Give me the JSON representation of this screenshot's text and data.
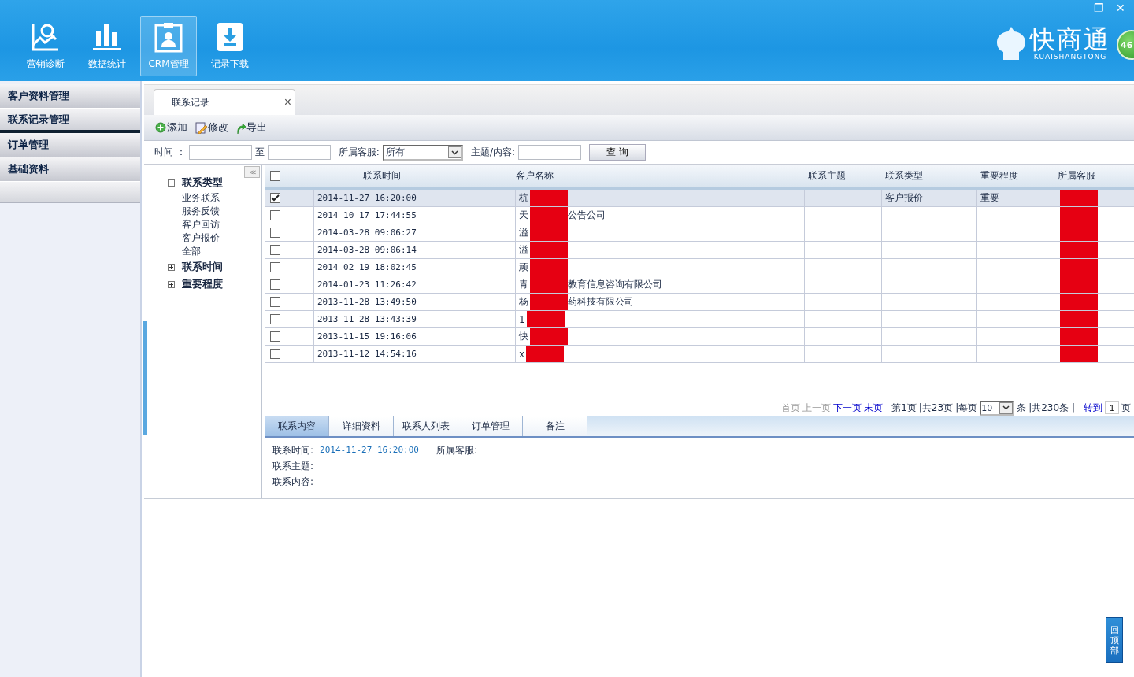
{
  "window": {
    "controls": [
      "–",
      "❐",
      "✕"
    ],
    "logo": {
      "name": "快商通",
      "sub": "KUAISHANGTONG"
    },
    "badge": "46"
  },
  "nav": [
    {
      "label": "营销诊断",
      "selected": false
    },
    {
      "label": "数据统计",
      "selected": false
    },
    {
      "label": "CRM管理",
      "selected": true
    },
    {
      "label": "记录下载",
      "selected": false
    }
  ],
  "sidebar": {
    "items": [
      {
        "label": "客户资料管理",
        "selected": false
      },
      {
        "label": "联系记录管理",
        "selected": true
      },
      {
        "label": "订单管理",
        "selected": false
      },
      {
        "label": "基础资料",
        "selected": false
      }
    ]
  },
  "tabs": [
    {
      "label": "联系记录",
      "close": "×",
      "selected": true
    }
  ],
  "toolbar": [
    {
      "label": "添加"
    },
    {
      "label": "修改"
    },
    {
      "label": "导出"
    }
  ],
  "filter": {
    "time_label": "时间 ：",
    "to_label": "至",
    "service_label": "所属客服:",
    "service_value": "所有",
    "subject_label": "主题/内容:",
    "search_button": "查 询"
  },
  "tree": {
    "collapse": "<<",
    "items": [
      {
        "label": "联系类型",
        "expanded": true,
        "children": [
          {
            "label": "业务联系"
          },
          {
            "label": "服务反馈"
          },
          {
            "label": "客户回访"
          },
          {
            "label": "客户报价"
          },
          {
            "label": "全部"
          }
        ]
      },
      {
        "label": "联系时间",
        "expanded": false
      },
      {
        "label": "重要程度",
        "expanded": false
      }
    ]
  },
  "table": {
    "select_all_checked": false,
    "columns": [
      "联系时间",
      "客户名称",
      "联系主题",
      "联系类型",
      "重要程度",
      "所属客服"
    ],
    "rows": [
      {
        "checked": true,
        "selected": true,
        "time": "2014-11-27 16:20:00",
        "name_start": "杭",
        "name_end": "",
        "subject": "",
        "type": "客户报价",
        "importance": "重要"
      },
      {
        "checked": false,
        "selected": false,
        "time": "2014-10-17 17:44:55",
        "name_start": "天",
        "name_end": "公告公司",
        "subject": "",
        "type": "",
        "importance": ""
      },
      {
        "checked": false,
        "selected": false,
        "time": "2014-03-28 09:06:27",
        "name_start": "溢",
        "name_end": "",
        "subject": "",
        "type": "",
        "importance": ""
      },
      {
        "checked": false,
        "selected": false,
        "time": "2014-03-28 09:06:14",
        "name_start": "溢",
        "name_end": "",
        "subject": "",
        "type": "",
        "importance": ""
      },
      {
        "checked": false,
        "selected": false,
        "time": "2014-02-19 18:02:45",
        "name_start": "顽",
        "name_end": "",
        "subject": "",
        "type": "",
        "importance": ""
      },
      {
        "checked": false,
        "selected": false,
        "time": "2014-01-23 11:26:42",
        "name_start": "青",
        "name_end": "教育信息咨询有限公司",
        "subject": "",
        "type": "",
        "importance": ""
      },
      {
        "checked": false,
        "selected": false,
        "time": "2013-11-28 13:49:50",
        "name_start": "杨",
        "name_end": "药科技有限公司",
        "subject": "",
        "type": "",
        "importance": ""
      },
      {
        "checked": false,
        "selected": false,
        "time": "2013-11-28 13:43:39",
        "name_start": "1",
        "name_end": "",
        "subject": "",
        "type": "",
        "importance": ""
      },
      {
        "checked": false,
        "selected": false,
        "time": "2013-11-15 19:16:06",
        "name_start": "快",
        "name_end": "",
        "subject": "",
        "type": "",
        "importance": ""
      },
      {
        "checked": false,
        "selected": false,
        "time": "2013-11-12 14:54:16",
        "name_start": "x",
        "name_end": "",
        "subject": "",
        "type": "",
        "importance": ""
      }
    ]
  },
  "pager": {
    "first": "首页",
    "prev": "上一页",
    "next": "下一页",
    "last": "末页",
    "page": "第1页",
    "pages": "|共23页",
    "per_page_label": "|每页",
    "per_page": "10",
    "unit": "条",
    "total": "|共230条 |",
    "goto": "转到",
    "goto_value": "1",
    "goto_unit": "页"
  },
  "detail_tabs": [
    {
      "label": "联系内容",
      "selected": true
    },
    {
      "label": "详细资料",
      "selected": false
    },
    {
      "label": "联系人列表",
      "selected": false
    },
    {
      "label": "订单管理",
      "selected": false
    },
    {
      "label": "备注",
      "selected": false
    }
  ],
  "detail": {
    "time_label": "联系时间:",
    "time_value": "2014-11-27 16:20:00",
    "service_label": "所属客服:",
    "subject_label": "联系主题:",
    "content_label": "联系内容:"
  },
  "back_to_top": "回顶部"
}
